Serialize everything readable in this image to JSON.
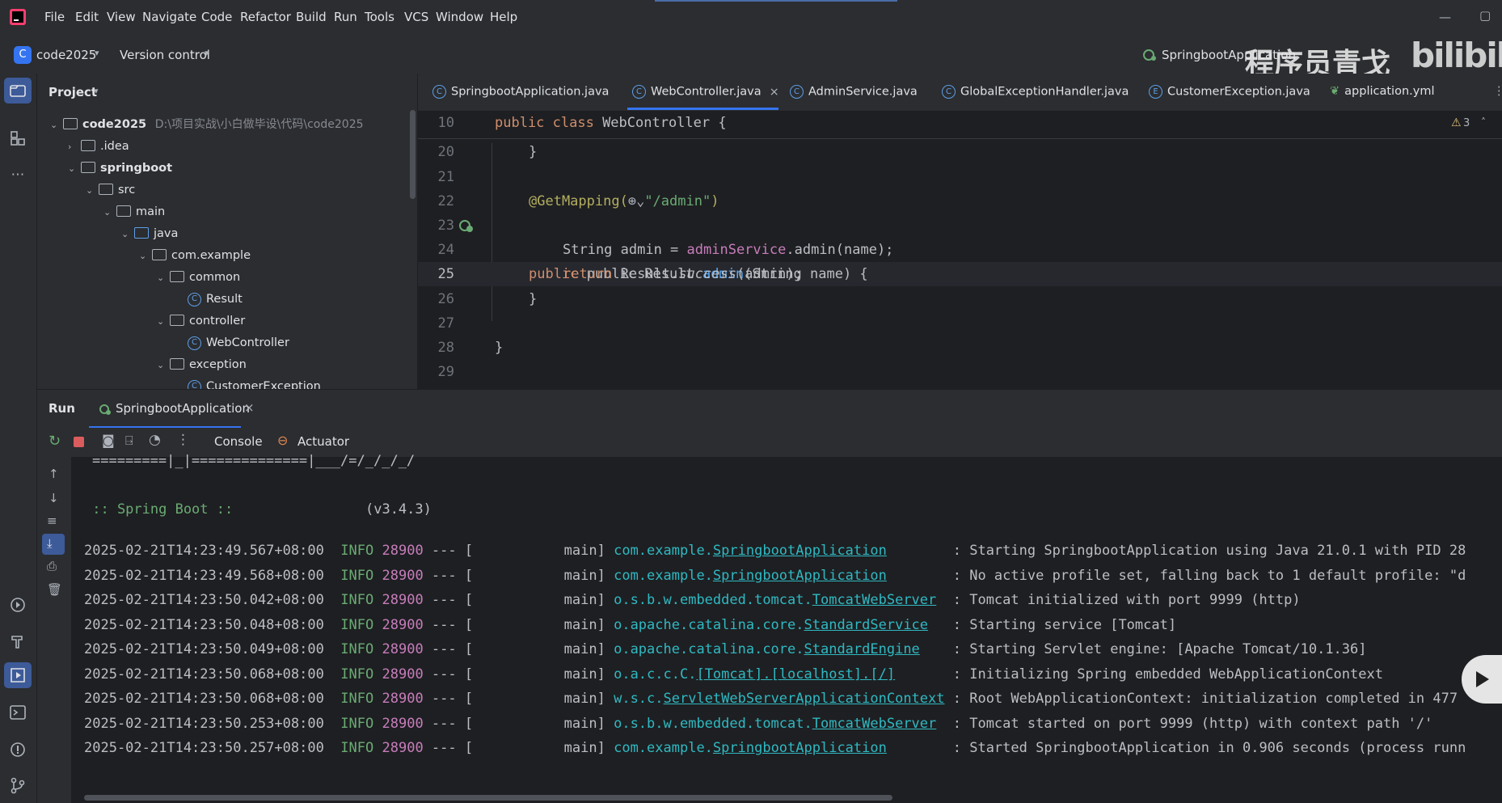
{
  "menu": [
    "File",
    "Edit",
    "View",
    "Navigate",
    "Code",
    "Refactor",
    "Build",
    "Run",
    "Tools",
    "VCS",
    "Window",
    "Help"
  ],
  "toolbar": {
    "project_name": "code2025",
    "project_letter": "C",
    "vcs_label": "Version control",
    "run_config": "SpringbootApplication"
  },
  "watermark": {
    "text": "程序员青戈",
    "brand": "bilibili"
  },
  "project_panel": {
    "title": "Project",
    "root": "code2025",
    "root_path": "D:\\项目实战\\小白做毕设\\代码\\code2025",
    "items": [
      ".idea",
      "springboot",
      "src",
      "main",
      "java",
      "com.example",
      "common",
      "Result",
      "controller",
      "WebController",
      "exception",
      "CustomerException"
    ]
  },
  "tabs": [
    "SpringbootApplication.java",
    "WebController.java",
    "AdminService.java",
    "GlobalExceptionHandler.java",
    "CustomerException.java",
    "application.yml"
  ],
  "editor": {
    "warnings": "3",
    "sticky_line_no": "10",
    "sticky_line": "public class WebController {",
    "line_numbers": [
      "20",
      "21",
      "22",
      "23",
      "24",
      "25",
      "26",
      "27",
      "28",
      "29"
    ],
    "lines": {
      "l20": "}",
      "l22_ann": "@GetMapping(",
      "l22_str": "\"/admin\"",
      "l22_end": ")",
      "l23_pre": "public Result ",
      "l23_fn": "admin",
      "l23_post": "(String name) {",
      "l24_pre": "String admin = ",
      "l24_field": "adminService",
      "l24_post": ".admin(name);",
      "l25_kw": "return",
      "l25_pre": " Result.",
      "l25_it": "success",
      "l25_post": "(admin);",
      "l26": "}",
      "l28": "}"
    }
  },
  "run": {
    "title": "Run",
    "tab": "SpringbootApplication",
    "console_tab": "Console",
    "actuator_tab": "Actuator",
    "banner_line": "=========|_|==============|___/=/_/_/_/",
    "spring_label": " :: Spring Boot :: ",
    "spring_version": "               (v3.4.3)",
    "logs": [
      {
        "ts": "2025-02-21T14:23:49.567+08:00",
        "level": "INFO",
        "pid": "28900",
        "sep": " --- [           main] ",
        "pkg": "com.example.",
        "cls": "SpringbootApplication",
        "pad": "        ",
        "msg": ": Starting SpringbootApplication using Java 21.0.1 with PID 28"
      },
      {
        "ts": "2025-02-21T14:23:49.568+08:00",
        "level": "INFO",
        "pid": "28900",
        "sep": " --- [           main] ",
        "pkg": "com.example.",
        "cls": "SpringbootApplication",
        "pad": "        ",
        "msg": ": No active profile set, falling back to 1 default profile: \"d"
      },
      {
        "ts": "2025-02-21T14:23:50.042+08:00",
        "level": "INFO",
        "pid": "28900",
        "sep": " --- [           main] ",
        "pkg": "o.s.b.w.embedded.tomcat.",
        "cls": "TomcatWebServer",
        "pad": "  ",
        "msg": ": Tomcat initialized with port 9999 (http)"
      },
      {
        "ts": "2025-02-21T14:23:50.048+08:00",
        "level": "INFO",
        "pid": "28900",
        "sep": " --- [           main] ",
        "pkg": "o.apache.catalina.core.",
        "cls": "StandardService",
        "pad": "   ",
        "msg": ": Starting service [Tomcat]"
      },
      {
        "ts": "2025-02-21T14:23:50.049+08:00",
        "level": "INFO",
        "pid": "28900",
        "sep": " --- [           main] ",
        "pkg": "o.apache.catalina.core.",
        "cls": "StandardEngine",
        "pad": "    ",
        "msg": ": Starting Servlet engine: [Apache Tomcat/10.1.36]"
      },
      {
        "ts": "2025-02-21T14:23:50.068+08:00",
        "level": "INFO",
        "pid": "28900",
        "sep": " --- [           main] ",
        "pkg": "o.a.c.c.C.",
        "cls": "[Tomcat].[localhost].[/]",
        "pad": "       ",
        "msg": ": Initializing Spring embedded WebApplicationContext"
      },
      {
        "ts": "2025-02-21T14:23:50.068+08:00",
        "level": "INFO",
        "pid": "28900",
        "sep": " --- [           main] ",
        "pkg": "w.s.c.",
        "cls": "ServletWebServerApplicationContext",
        "pad": " ",
        "msg": ": Root WebApplicationContext: initialization completed in 477"
      },
      {
        "ts": "2025-02-21T14:23:50.253+08:00",
        "level": "INFO",
        "pid": "28900",
        "sep": " --- [           main] ",
        "pkg": "o.s.b.w.embedded.tomcat.",
        "cls": "TomcatWebServer",
        "pad": "  ",
        "msg": ": Tomcat started on port 9999 (http) with context path '/'"
      },
      {
        "ts": "2025-02-21T14:23:50.257+08:00",
        "level": "INFO",
        "pid": "28900",
        "sep": " --- [           main] ",
        "pkg": "com.example.",
        "cls": "SpringbootApplication",
        "pad": "        ",
        "msg": ": Started SpringbootApplication in 0.906 seconds (process runn"
      }
    ]
  }
}
